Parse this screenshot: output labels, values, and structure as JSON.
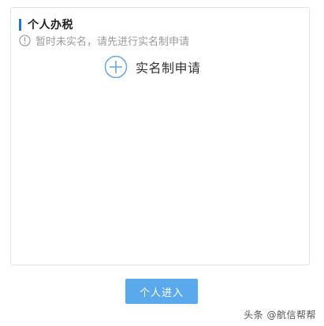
{
  "section": {
    "title": "个人办税"
  },
  "notice": {
    "text": "暂时未实名，请先进行实名制申请",
    "icon": "warning-circle-icon"
  },
  "apply": {
    "label": "实名制申请",
    "icon": "plus-circle-icon"
  },
  "enter_button": {
    "label": "个人进入"
  },
  "watermark": {
    "text": "头条 @航信帮帮"
  },
  "colors": {
    "accent": "#1e78d6",
    "button": "#5aa9ec",
    "notice_text": "#9a9a9a",
    "border": "#e3e3e3"
  }
}
